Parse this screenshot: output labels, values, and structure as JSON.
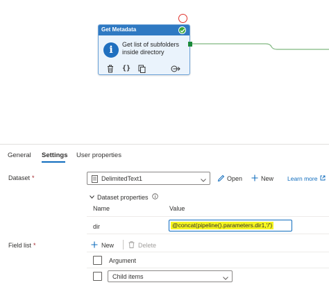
{
  "activity": {
    "title": "Get Metadata",
    "description": "Get list of subfolders inside directory",
    "status_icon": "check-icon",
    "status_color": "#3ba83b",
    "header_color": "#2f79c2"
  },
  "tabs": [
    {
      "label": "General"
    },
    {
      "label": "Settings"
    },
    {
      "label": "User properties"
    }
  ],
  "dataset": {
    "label": "Dataset",
    "required": "*",
    "selected": "DelimitedText1",
    "open_label": "Open",
    "new_label": "New",
    "learn_more": "Learn more"
  },
  "dataset_properties": {
    "title": "Dataset properties",
    "columns": [
      "Name",
      "Value"
    ],
    "rows": [
      {
        "name": "dir",
        "value": "@concat(pipeline().parameters.dir1,'/')"
      }
    ]
  },
  "field_list": {
    "label": "Field list",
    "required": "*",
    "new_label": "New",
    "delete_label": "Delete",
    "header": "Argument",
    "item_selected": "Child items"
  },
  "colors": {
    "accent": "#0f6cbd",
    "highlight": "#f5f520",
    "port": "#1a8a3a"
  }
}
